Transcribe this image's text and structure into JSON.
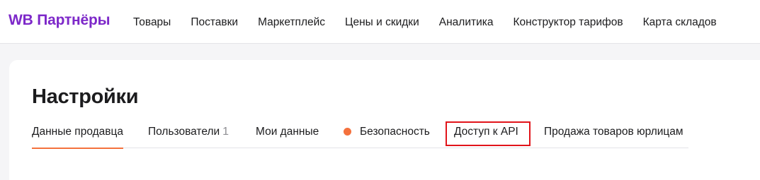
{
  "header": {
    "logo": "WB Партнёры",
    "nav": [
      "Товары",
      "Поставки",
      "Маркетплейс",
      "Цены и скидки",
      "Аналитика",
      "Конструктор тарифов",
      "Карта складов"
    ]
  },
  "page": {
    "title": "Настройки",
    "tabs": [
      {
        "label": "Данные продавца",
        "active": true
      },
      {
        "label": "Пользователи",
        "count": "1"
      },
      {
        "label": "Мои данные"
      },
      {
        "label": "Безопасность"
      },
      {
        "label": "Доступ к API"
      },
      {
        "label": "Продажа товаров юрлицам"
      }
    ]
  },
  "colors": {
    "brand": "#7d28c9",
    "accent": "#f4713d",
    "highlight": "#e1141a"
  }
}
